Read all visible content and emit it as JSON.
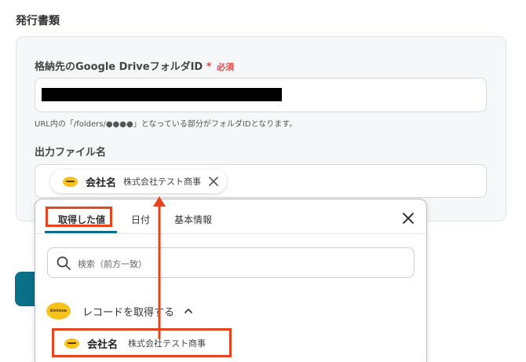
{
  "section": {
    "title": "発行書類"
  },
  "folder_field": {
    "label": "格納先のGoogle DriveフォルダID",
    "required_mark": "*",
    "required_text": "必須",
    "help": "URL内の「/folders/●●●●」となっている部分がフォルダIDとなります。"
  },
  "filename_field": {
    "label": "出力ファイル名",
    "chip": {
      "name": "会社名",
      "value": "株式会社テスト商事",
      "icon": "kintone-icon"
    }
  },
  "dropdown": {
    "tabs": [
      {
        "label": "取得した値",
        "active": true
      },
      {
        "label": "日付",
        "active": false
      },
      {
        "label": "基本情報",
        "active": false
      }
    ],
    "search_placeholder": "検索（前方一致）",
    "group": {
      "logo_text": "kintone",
      "label": "レコードを取得する",
      "expanded": true
    },
    "items": [
      {
        "name": "会社名",
        "value": "株式会社テスト商事",
        "icon": "kintone-icon"
      }
    ]
  },
  "colors": {
    "accent": "#0b6f87",
    "required": "#e5484d",
    "annotation": "#e8431f",
    "kintone": "#f8c21d"
  }
}
